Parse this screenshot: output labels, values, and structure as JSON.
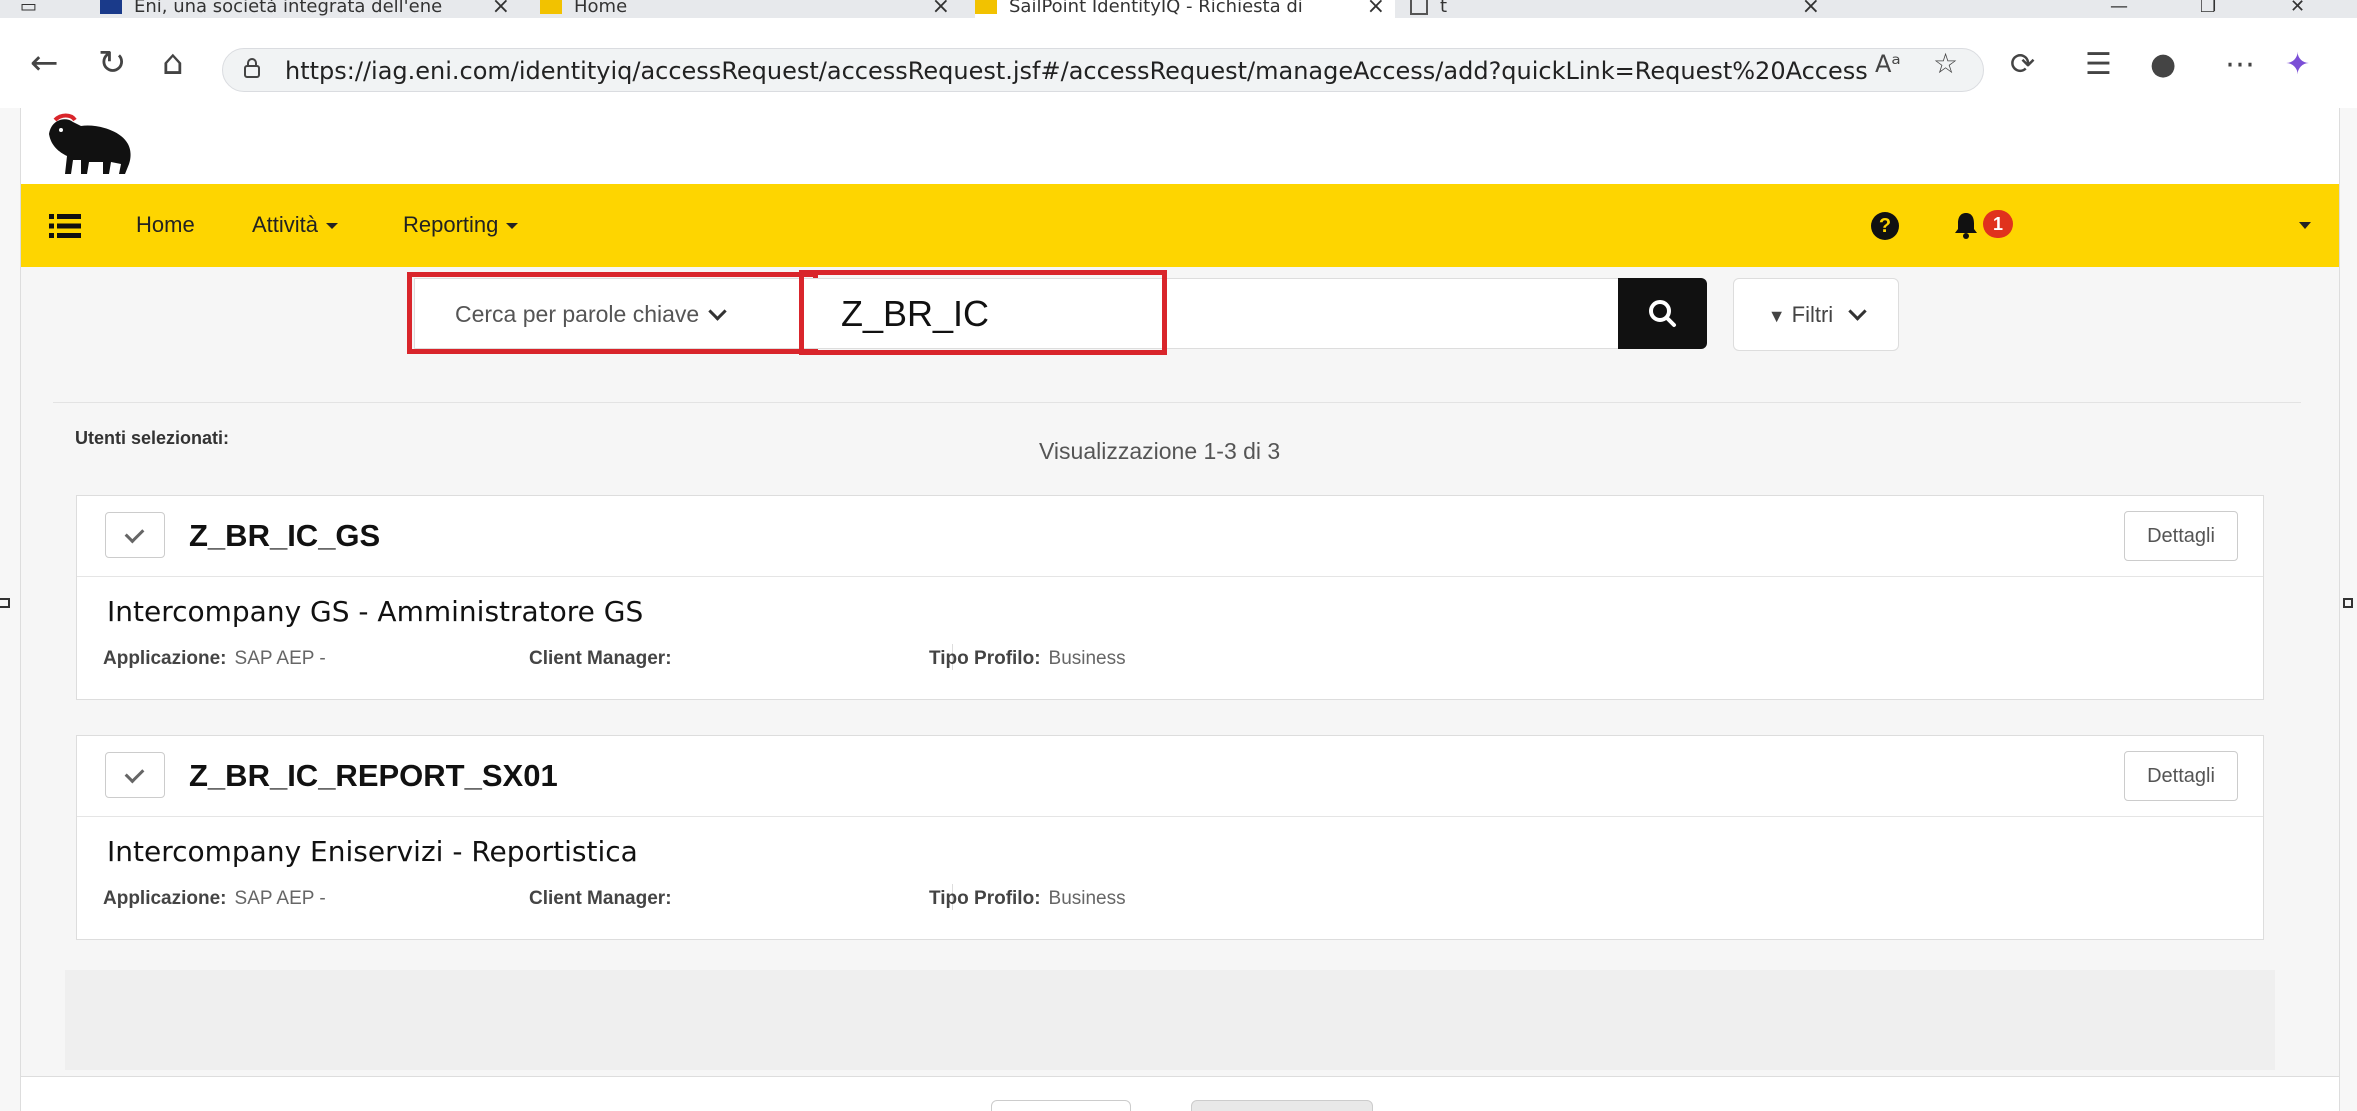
{
  "browser": {
    "tabs": [
      {
        "label": "Eni, una società integrata dell'ene"
      },
      {
        "label": "Home"
      },
      {
        "label": "SailPoint IdentityIQ - Richiesta di"
      },
      {
        "label": "t"
      }
    ],
    "url": "https://iag.eni.com/identityiq/accessRequest/accessRequest.jsf#/accessRequest/manageAccess/add?quickLink=Request%20Access"
  },
  "navbar": {
    "home": "Home",
    "activities": "Attività",
    "reporting": "Reporting",
    "notification_count": "1"
  },
  "search": {
    "mode_label": "Cerca per parole chiave",
    "query": "Z_BR_IC",
    "filters_label": "Filtri"
  },
  "results": {
    "selected_users_label": "Utenti selezionati:",
    "count_text": "Visualizzazione 1-3 di 3",
    "items": [
      {
        "name": "Z_BR_IC_GS",
        "description": "Intercompany GS - Amministratore GS",
        "application_label": "Applicazione:",
        "application_value": "SAP AEP -",
        "client_manager_label": "Client Manager:",
        "profile_type_label": "Tipo Profilo:",
        "profile_type_value": "Business",
        "details_label": "Dettagli"
      },
      {
        "name": "Z_BR_IC_REPORT_SX01",
        "description": "Intercompany Eniservizi - Reportistica",
        "application_label": "Applicazione:",
        "application_value": "SAP AEP -",
        "client_manager_label": "Client Manager:",
        "profile_type_label": "Tipo Profilo:",
        "profile_type_value": "Business",
        "details_label": "Dettagli"
      }
    ]
  },
  "colors": {
    "navbar": "#fed500",
    "highlight": "#d9252b",
    "badge": "#e0321d"
  }
}
